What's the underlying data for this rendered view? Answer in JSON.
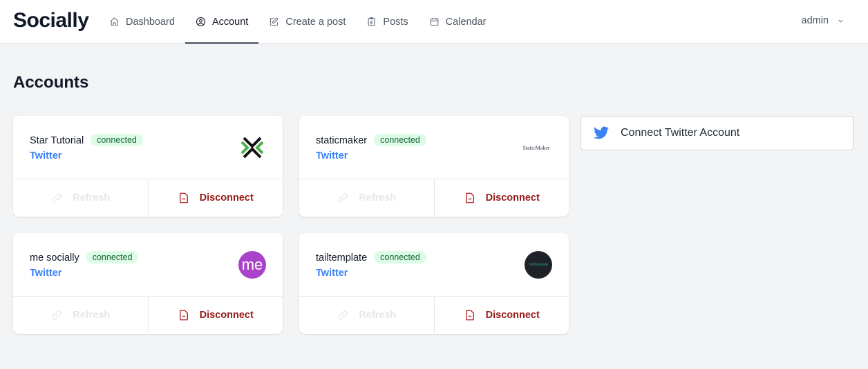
{
  "app": {
    "logo": "Socially"
  },
  "nav": {
    "items": [
      {
        "label": "Dashboard",
        "icon": "home-icon",
        "active": false
      },
      {
        "label": "Account",
        "icon": "user-circle-icon",
        "active": true
      },
      {
        "label": "Create a post",
        "icon": "edit-icon",
        "active": false
      },
      {
        "label": "Posts",
        "icon": "clipboard-icon",
        "active": false
      },
      {
        "label": "Calendar",
        "icon": "calendar-icon",
        "active": false
      }
    ],
    "user": {
      "label": "admin",
      "icon": "chevron-down-icon"
    }
  },
  "page": {
    "title": "Accounts"
  },
  "accounts": [
    {
      "name": "Star Tutorial",
      "status": "connected",
      "platform": "Twitter",
      "avatar": "star-tutorial-logo",
      "avatar_text": "",
      "refresh_label": "Refresh",
      "disconnect_label": "Disconnect"
    },
    {
      "name": "staticmaker",
      "status": "connected",
      "platform": "Twitter",
      "avatar": "staticmaker-logo",
      "avatar_text": "StaticMaker",
      "refresh_label": "Refresh",
      "disconnect_label": "Disconnect"
    },
    {
      "name": "me socially",
      "status": "connected",
      "platform": "Twitter",
      "avatar": "me-socially-logo",
      "avatar_text": "me",
      "refresh_label": "Refresh",
      "disconnect_label": "Disconnect"
    },
    {
      "name": "tailtemplate",
      "status": "connected",
      "platform": "Twitter",
      "avatar": "tailtemplate-logo",
      "avatar_text": "TailTemplate",
      "refresh_label": "Refresh",
      "disconnect_label": "Disconnect"
    }
  ],
  "connect": {
    "label": "Connect Twitter Account",
    "icon": "twitter-icon"
  },
  "colors": {
    "accent": "#3b82f6",
    "danger": "#991b1b",
    "badge_bg": "#dcfce7",
    "badge_text": "#166534"
  }
}
